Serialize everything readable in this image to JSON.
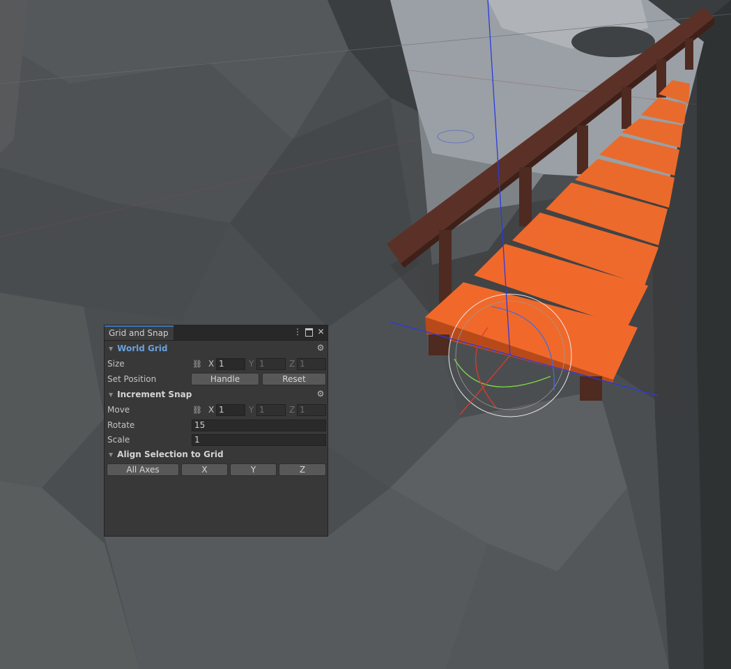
{
  "panel": {
    "tab_title": "Grid and Snap",
    "icons": [
      "kebab-menu-icon",
      "maximize-icon",
      "close-icon"
    ],
    "world_grid": {
      "title": "World Grid",
      "size_label": "Size",
      "size": {
        "x_label": "X",
        "x": "1",
        "y_label": "Y",
        "y": "1",
        "z_label": "Z",
        "z": "1"
      },
      "set_position_label": "Set Position",
      "handle_label": "Handle",
      "reset_label": "Reset"
    },
    "increment_snap": {
      "title": "Increment Snap",
      "move_label": "Move",
      "move": {
        "x_label": "X",
        "x": "1",
        "y_label": "Y",
        "y": "1",
        "z_label": "Z",
        "z": "1"
      },
      "rotate_label": "Rotate",
      "rotate": "15",
      "scale_label": "Scale",
      "scale": "1"
    },
    "align": {
      "title": "Align Selection to Grid",
      "all_axes_label": "All Axes",
      "x_label": "X",
      "y_label": "Y",
      "z_label": "Z"
    }
  },
  "colors": {
    "accent": "#6aa1de",
    "tab_highlight": "#3a79bb",
    "bridge_plank": "#f0692a",
    "bridge_rail": "#5b3127",
    "axis_x": "#e23a2a",
    "axis_y": "#7fd64a",
    "axis_z": "#2a3ae2"
  }
}
